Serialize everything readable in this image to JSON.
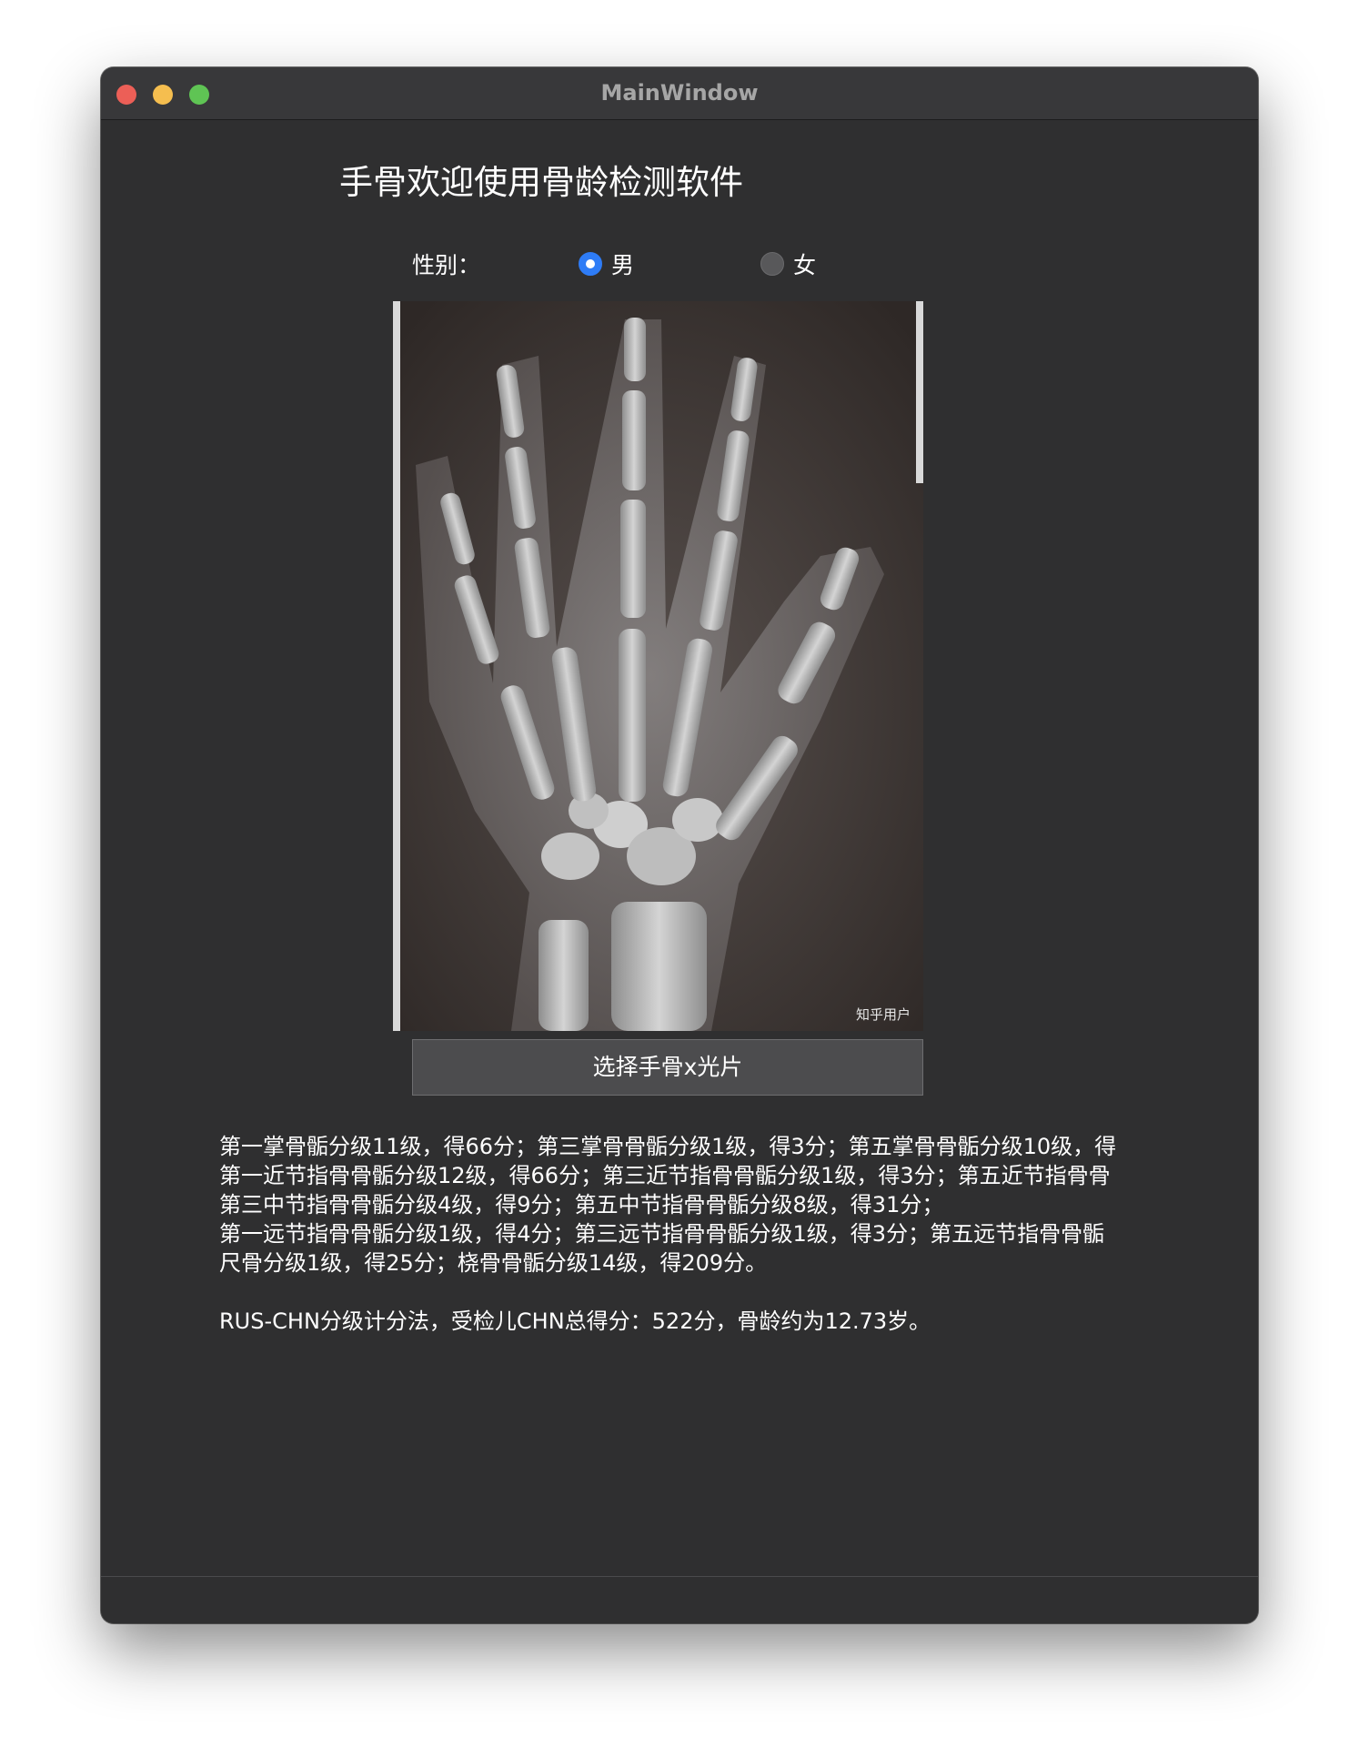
{
  "window": {
    "title": "MainWindow"
  },
  "heading": "手骨欢迎使用骨龄检测软件",
  "gender": {
    "label": "性别：",
    "options": [
      {
        "label": "男",
        "checked": true
      },
      {
        "label": "女",
        "checked": false
      }
    ]
  },
  "image": {
    "description_icon": "hand-xray-image",
    "watermark": "知乎用户"
  },
  "select_button": "选择手骨x光片",
  "results": {
    "lines": [
      "第一掌骨骺分级11级，得66分；第三掌骨骨骺分级1级，得3分；第五掌骨骨骺分级10级，得",
      "第一近节指骨骨骺分级12级，得66分；第三近节指骨骨骺分级1级，得3分；第五近节指骨骨",
      "第三中节指骨骨骺分级4级，得9分；第五中节指骨骨骺分级8级，得31分；",
      "第一远节指骨骨骺分级1级，得4分；第三远节指骨骨骺分级1级，得3分；第五远节指骨骨骺",
      "尺骨分级1级，得25分；桡骨骨骺分级14级，得209分。"
    ],
    "summary": "RUS-CHN分级计分法，受检儿CHN总得分：522分，骨龄约为12.73岁。"
  },
  "colors": {
    "window_bg": "#2f2f30",
    "titlebar_bg": "#38383a",
    "accent": "#2e7cf6",
    "close": "#ec5f57",
    "minimize": "#f5be4f",
    "maximize": "#5fc454"
  }
}
